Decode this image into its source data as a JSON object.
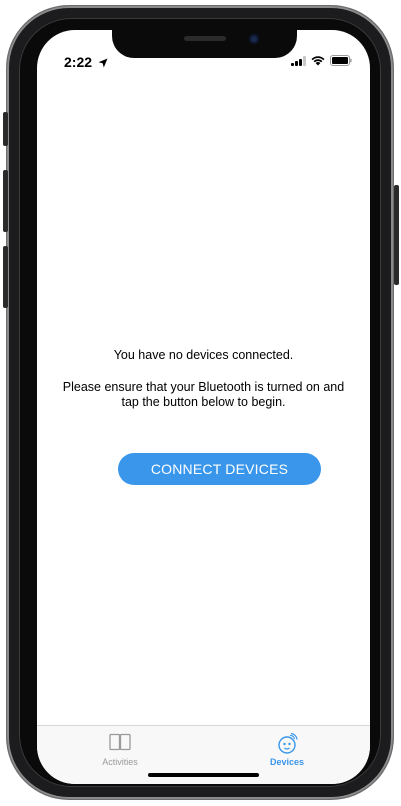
{
  "status_bar": {
    "time": "2:22"
  },
  "main": {
    "message_line1": "You have no devices connected.",
    "message_line2": "Please ensure that your Bluetooth is turned on and tap the button below to begin.",
    "connect_button_label": "CONNECT DEVICES"
  },
  "tab_bar": {
    "tabs": [
      {
        "label": "Activities",
        "icon": "book-icon",
        "selected": false
      },
      {
        "label": "Devices",
        "icon": "device-icon",
        "selected": true
      }
    ]
  },
  "colors": {
    "accent": "#3996ea",
    "inactive_tab": "#9a9a9a"
  }
}
